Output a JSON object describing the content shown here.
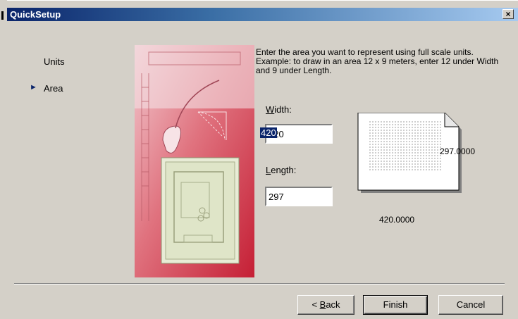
{
  "window": {
    "title": "QuickSetup",
    "close_label": "×"
  },
  "nav": {
    "items": [
      {
        "label": "Units",
        "active": false
      },
      {
        "label": "Area",
        "active": true
      }
    ],
    "active_marker": "►"
  },
  "instructions": "Enter the area you want to represent using full scale units.  Example: to draw in an area 12 x 9 meters, enter 12 under Width and 9 under Length.",
  "width": {
    "label_mnemonic": "W",
    "label_rest": "idth:",
    "value": "420"
  },
  "length": {
    "label_mnemonic": "L",
    "label_rest": "ength:",
    "value": "297"
  },
  "preview": {
    "height_dim": "297.0000",
    "width_dim": "420.0000"
  },
  "buttons": {
    "back": {
      "prefix": "< ",
      "mnemonic": "B",
      "rest": "ack"
    },
    "finish": "Finish",
    "cancel": "Cancel"
  },
  "colors": {
    "title_start": "#0a246a",
    "title_end": "#a6caf0",
    "face": "#d4d0c8",
    "illustration_red": "#c8283c"
  }
}
